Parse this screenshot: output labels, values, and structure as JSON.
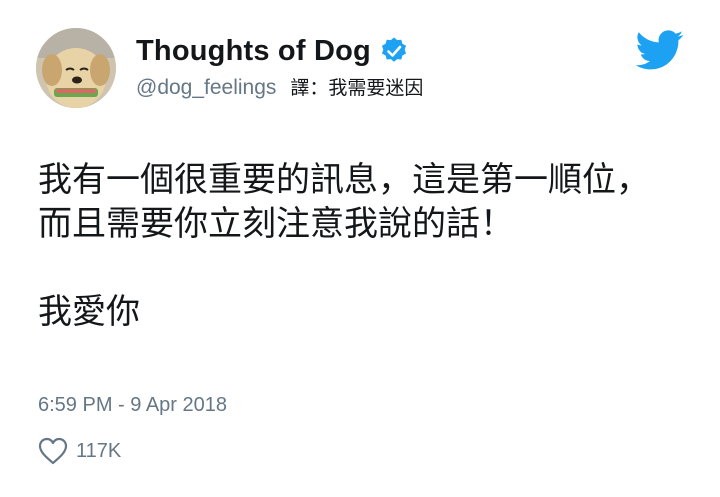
{
  "tweet": {
    "display_name": "Thoughts of Dog",
    "handle": "@dog_feelings",
    "translator_note": "譯：我需要迷因",
    "text_lines": [
      "我有一個很重要的訊息，這是第一順位，",
      "而且需要你立刻注意我說的話！",
      "我愛你"
    ],
    "timestamp": "6:59 PM - 9 Apr 2018",
    "likes": "117K"
  },
  "icons": {
    "verified": "verified-badge-icon",
    "brand": "twitter-bird-icon",
    "like": "heart-outline-icon"
  },
  "colors": {
    "brand": "#1da1f2",
    "text": "#14171a",
    "secondary": "#657786"
  }
}
